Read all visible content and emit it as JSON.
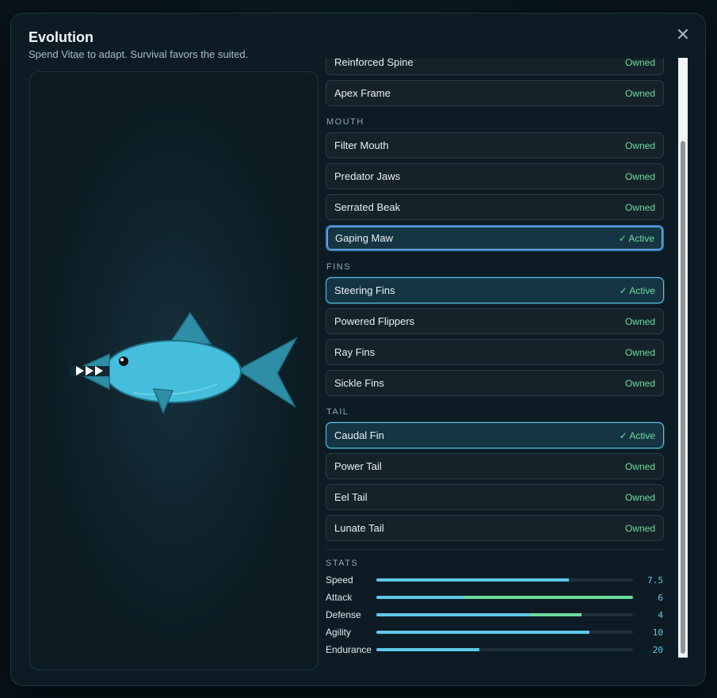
{
  "modal": {
    "title": "Evolution",
    "subtitle": "Spend Vitae to adapt. Survival favors the suited.",
    "close_glyph": "✕"
  },
  "partial_item": {
    "name": "Reinforced Spine",
    "state": "Owned"
  },
  "body_tail_item": {
    "name": "Apex Frame",
    "state": "Owned"
  },
  "sections": [
    {
      "label": "MOUTH",
      "items": [
        {
          "name": "Filter Mouth",
          "state": "Owned"
        },
        {
          "name": "Predator Jaws",
          "state": "Owned"
        },
        {
          "name": "Serrated Beak",
          "state": "Owned"
        },
        {
          "name": "Gaping Maw",
          "state": "✓ Active"
        }
      ]
    },
    {
      "label": "FINS",
      "items": [
        {
          "name": "Steering Fins",
          "state": "✓ Active"
        },
        {
          "name": "Powered Flippers",
          "state": "Owned"
        },
        {
          "name": "Ray Fins",
          "state": "Owned"
        },
        {
          "name": "Sickle Fins",
          "state": "Owned"
        }
      ]
    },
    {
      "label": "TAIL",
      "items": [
        {
          "name": "Caudal Fin",
          "state": "✓ Active"
        },
        {
          "name": "Power Tail",
          "state": "Owned"
        },
        {
          "name": "Eel Tail",
          "state": "Owned"
        },
        {
          "name": "Lunate Tail",
          "state": "Owned"
        }
      ]
    }
  ],
  "stats": {
    "label": "STATS",
    "rows": [
      {
        "name": "Speed",
        "value": "7.5",
        "base": 0.75,
        "bonus": 0
      },
      {
        "name": "Attack",
        "value": "6",
        "base": 0.34,
        "bonus": 0.66
      },
      {
        "name": "Defense",
        "value": "4",
        "base": 0.6,
        "bonus": 0.2
      },
      {
        "name": "Agility",
        "value": "10",
        "base": 0.83,
        "bonus": 0
      },
      {
        "name": "Endurance",
        "value": "20",
        "base": 0.4,
        "bonus": 0
      }
    ]
  },
  "colors": {
    "accent": "#56c6e6",
    "owned": "#6fdc9c",
    "stat_base": "#5fc9ea",
    "stat_bonus": "#6fdc9c",
    "creature_body": "#45bedb",
    "creature_fin": "#2e8ea6"
  }
}
